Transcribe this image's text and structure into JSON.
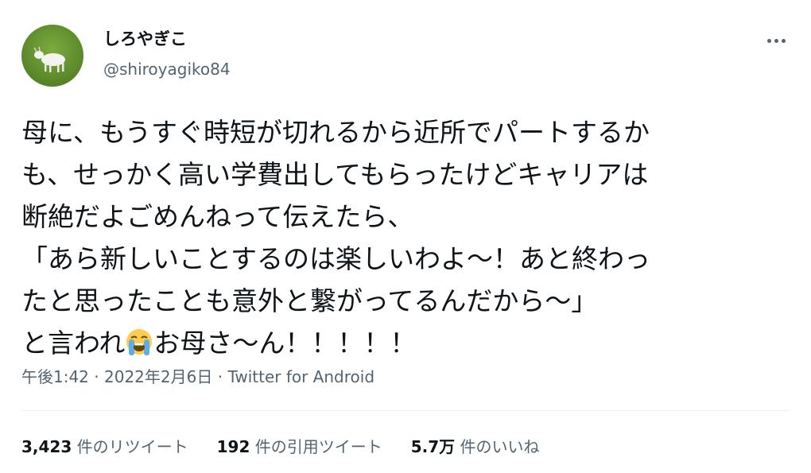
{
  "author": {
    "display_name": "しろやぎこ",
    "handle": "@shiroyagiko84",
    "avatar_icon": "goat-avatar-icon"
  },
  "menu": {
    "more_icon": "more-options-icon"
  },
  "tweet": {
    "lines": [
      "母に、もうすぐ時短が切れるから近所でパートするか",
      "も、せっかく高い学費出してもらったけどキャリアは",
      "断絶だよごめんねって伝えたら、",
      "「あら新しいことするのは楽しいわよ〜！あと終わっ",
      "たと思ったことも意外と繋がってるんだから〜」"
    ],
    "last_line_before_emoji": "と言われ",
    "emoji": "loudly-crying-face-emoji",
    "last_line_after_emoji": "お母さ〜ん！！！！！"
  },
  "meta": {
    "time": "午後1:42",
    "separator": " · ",
    "date": "2022年2月6日",
    "source": "Twitter for Android"
  },
  "stats": {
    "retweets": {
      "count": "3,423",
      "label": " 件のリツイート"
    },
    "quotes": {
      "count": "192",
      "label": " 件の引用ツイート"
    },
    "likes": {
      "count": "5.7万",
      "label": " 件のいいね"
    }
  },
  "colors": {
    "primary_text": "#0f1419",
    "secondary_text": "#536471",
    "divider": "#eff3f4"
  }
}
